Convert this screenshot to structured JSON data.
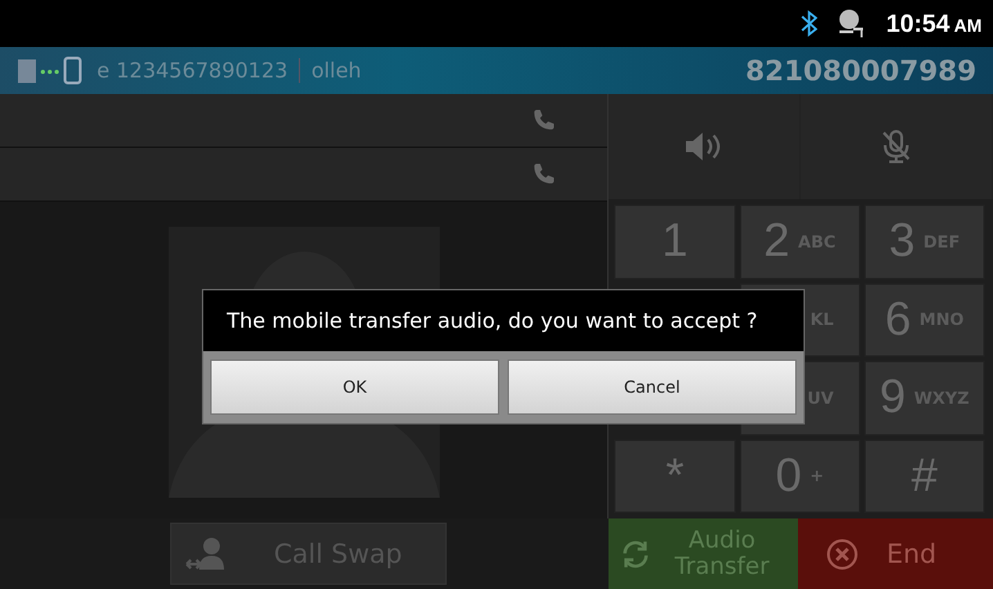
{
  "status_bar": {
    "time": "10:54",
    "ampm": "AM"
  },
  "call_header": {
    "line_text": "e 1234567890123",
    "carrier": "olleh",
    "number": "821080007989"
  },
  "call_rows": [
    {
      "kind": "call"
    },
    {
      "kind": "call"
    }
  ],
  "audio_controls": [
    {
      "kind": "speaker",
      "on": false
    },
    {
      "kind": "mute",
      "on": false
    }
  ],
  "keypad_rows": [
    [
      {
        "digit": "1"
      },
      {
        "digit": "2",
        "letters": "ABC"
      },
      {
        "digit": "3",
        "letters": "DEF"
      }
    ],
    [
      {
        "letters": "KL"
      },
      {
        "digit": "6",
        "letters": "MNO"
      }
    ],
    [
      {
        "letters": "UV"
      },
      {
        "digit": "9",
        "letters": "WXYZ"
      }
    ],
    [
      {
        "digit": "*"
      },
      {
        "digit": "0",
        "letters": "+"
      },
      {
        "digit": "#"
      }
    ]
  ],
  "call_swap": {
    "label": "Call Swap"
  },
  "audio_transfer": {
    "label": "Audio Transfer"
  },
  "end": {
    "label": "End"
  },
  "dialog": {
    "message": "The mobile transfer audio, do you want to accept ?",
    "buttons": [
      "OK",
      "Cancel"
    ]
  }
}
